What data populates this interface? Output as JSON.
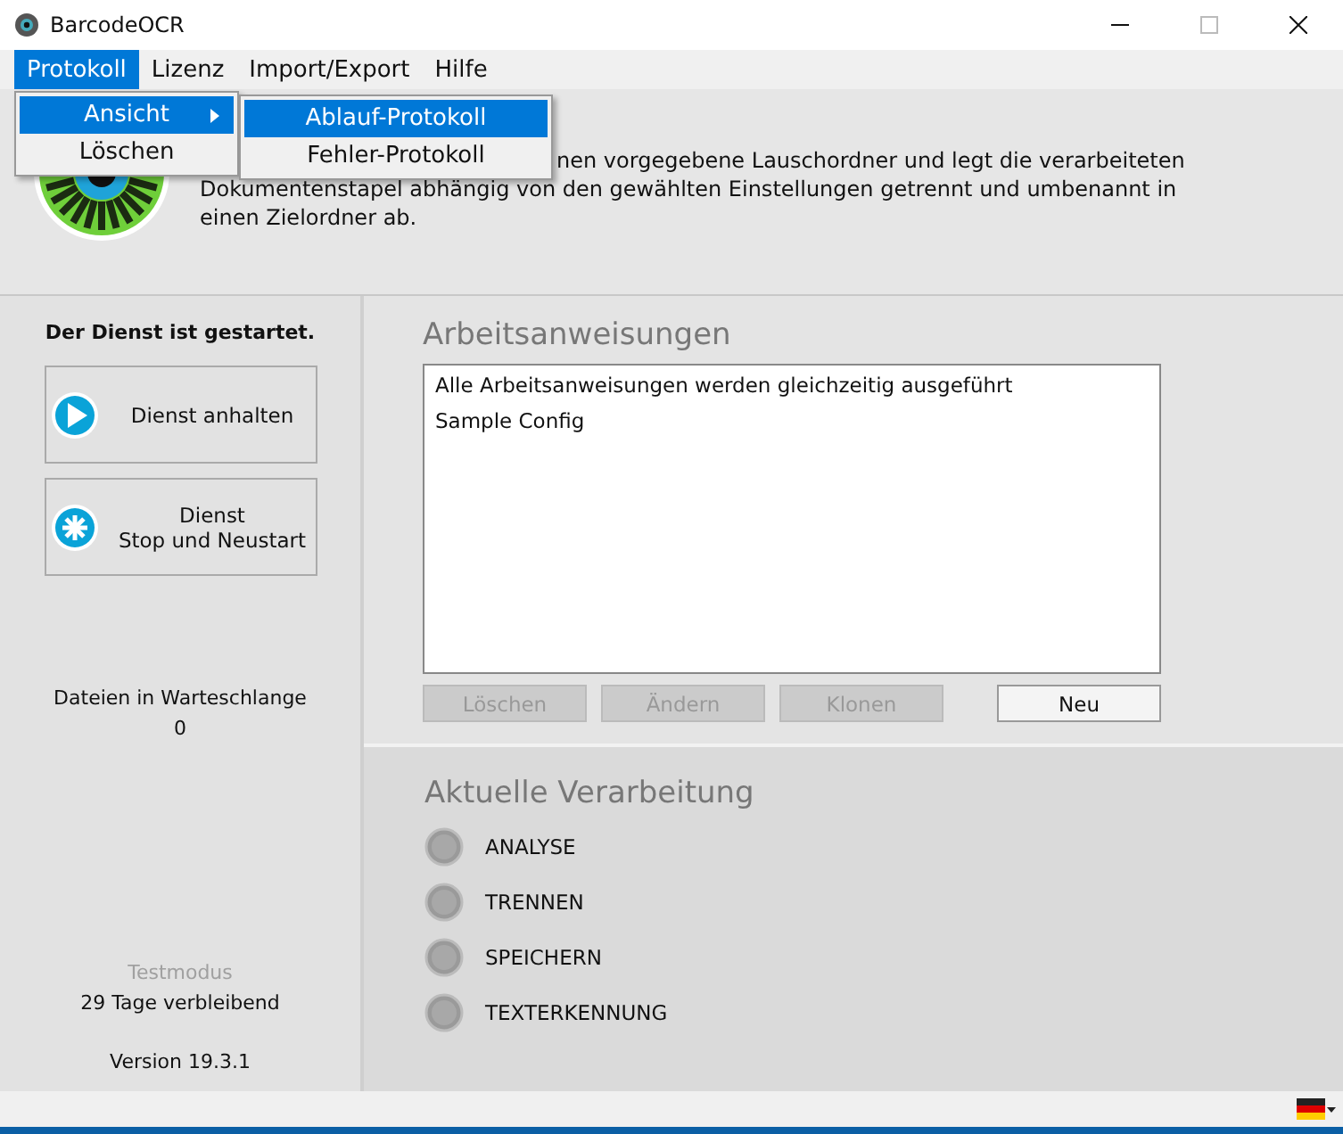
{
  "window": {
    "title": "BarcodeOCR"
  },
  "menu": [
    {
      "label": "Protokoll",
      "selected": true
    },
    {
      "label": "Lizenz",
      "selected": false
    },
    {
      "label": "Import/Export",
      "selected": false
    },
    {
      "label": "Hilfe",
      "selected": false
    }
  ],
  "dropdown": [
    {
      "label": "Ansicht",
      "selected": true,
      "submenu": true
    },
    {
      "label": "Löschen",
      "selected": false,
      "submenu": false
    }
  ],
  "submenu": [
    {
      "label": "Ablauf-Protokoll",
      "selected": true
    },
    {
      "label": "Fehler-Protokoll",
      "selected": false
    }
  ],
  "header": {
    "description_lines": [
      "nen vorgegebene Lauschordner und legt die verarbeiteten",
      "Dokumentenstapel abhängig von den gewählten Einstellungen getrennt und umbenannt in",
      "einen Zielordner ab."
    ]
  },
  "sidebar": {
    "status": "Der Dienst ist gestartet.",
    "buttons": [
      {
        "kind": "play",
        "label": "Dienst anhalten"
      },
      {
        "kind": "restart",
        "label": "Dienst\nStop und Neustart"
      }
    ],
    "queue_label": "Dateien in Warteschlange",
    "queue_count": "0",
    "mode": "Testmodus",
    "days": "29 Tage verbleibend",
    "version": "Version 19.3.1"
  },
  "work_instructions": {
    "title": "Arbeitsanweisungen",
    "items": [
      "Alle Arbeitsanweisungen werden gleichzeitig ausgeführt",
      "Sample Config"
    ],
    "buttons": [
      {
        "label": "Löschen",
        "disabled": true
      },
      {
        "label": "Ändern",
        "disabled": true
      },
      {
        "label": "Klonen",
        "disabled": true
      },
      {
        "label": "Neu",
        "disabled": false
      }
    ]
  },
  "processing": {
    "title": "Aktuelle Verarbeitung",
    "steps": [
      {
        "label": "ANALYSE",
        "active": false
      },
      {
        "label": "TRENNEN",
        "active": false
      },
      {
        "label": "SPEICHERN",
        "active": false
      },
      {
        "label": "TEXTERKENNUNG",
        "active": false
      }
    ]
  }
}
